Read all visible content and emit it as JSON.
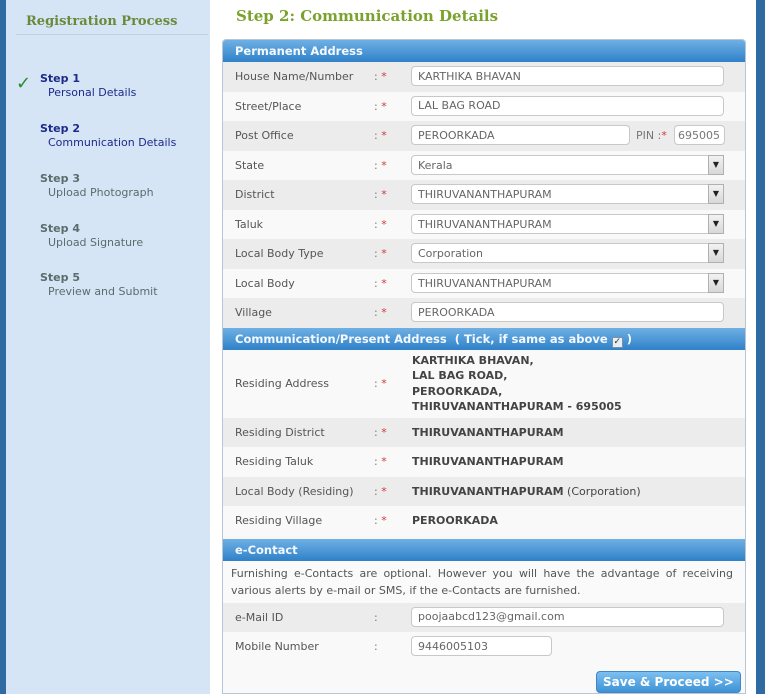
{
  "sidebar": {
    "title": "Registration Process",
    "check_icon": "✓",
    "steps": [
      {
        "num": "Step 1",
        "desc": "Personal Details",
        "state": "done"
      },
      {
        "num": "Step 2",
        "desc": "Communication Details",
        "state": "active"
      },
      {
        "num": "Step 3",
        "desc": "Upload Photograph",
        "state": "pending"
      },
      {
        "num": "Step 4",
        "desc": "Upload Signature",
        "state": "pending"
      },
      {
        "num": "Step 5",
        "desc": "Preview and Submit",
        "state": "pending"
      }
    ]
  },
  "page_title": "Step 2: Communication Details",
  "common": {
    "colon": ":",
    "required_mark": "*",
    "dropdown_arrow": "▼"
  },
  "permanent": {
    "header": "Permanent Address",
    "house_label": "House Name/Number",
    "house_value": "KARTHIKA BHAVAN",
    "street_label": "Street/Place",
    "street_value": "LAL BAG ROAD",
    "post_label": "Post Office",
    "post_value": "PEROORKADA",
    "pin_label": "PIN :",
    "pin_value": "695005",
    "state_label": "State",
    "state_value": "Kerala",
    "district_label": "District",
    "district_value": "THIRUVANANTHAPURAM",
    "taluk_label": "Taluk",
    "taluk_value": "THIRUVANANTHAPURAM",
    "lbtype_label": "Local Body Type",
    "lbtype_value": "Corporation",
    "lb_label": "Local Body",
    "lb_value": "THIRUVANANTHAPURAM",
    "village_label": "Village",
    "village_value": "PEROORKADA"
  },
  "present": {
    "header": "Communication/Present Address",
    "tick_text": "( Tick, if same as above",
    "tick_close": ")",
    "tick_checked": "✓",
    "address_label": "Residing Address",
    "address_lines": [
      "KARTHIKA BHAVAN,",
      "LAL BAG ROAD,",
      "PEROORKADA,",
      "THIRUVANANTHAPURAM - 695005"
    ],
    "district_label": "Residing District",
    "district_value": "THIRUVANANTHAPURAM",
    "taluk_label": "Residing Taluk",
    "taluk_value": "THIRUVANANTHAPURAM",
    "lb_label": "Local Body (Residing)",
    "lb_value": "THIRUVANANTHAPURAM",
    "lb_suffix": " (Corporation)",
    "village_label": "Residing Village",
    "village_value": "PEROORKADA"
  },
  "econtact": {
    "header": "e-Contact",
    "note": "Furnishing e-Contacts are optional. However you will have the advantage of receiving various alerts by e-mail or SMS, if the e-Contacts are furnished.",
    "email_label": "e-Mail ID",
    "email_value": "poojaabcd123@gmail.com",
    "mobile_label": "Mobile Number",
    "mobile_value": "9446005103"
  },
  "save_button": "Save & Proceed >>"
}
